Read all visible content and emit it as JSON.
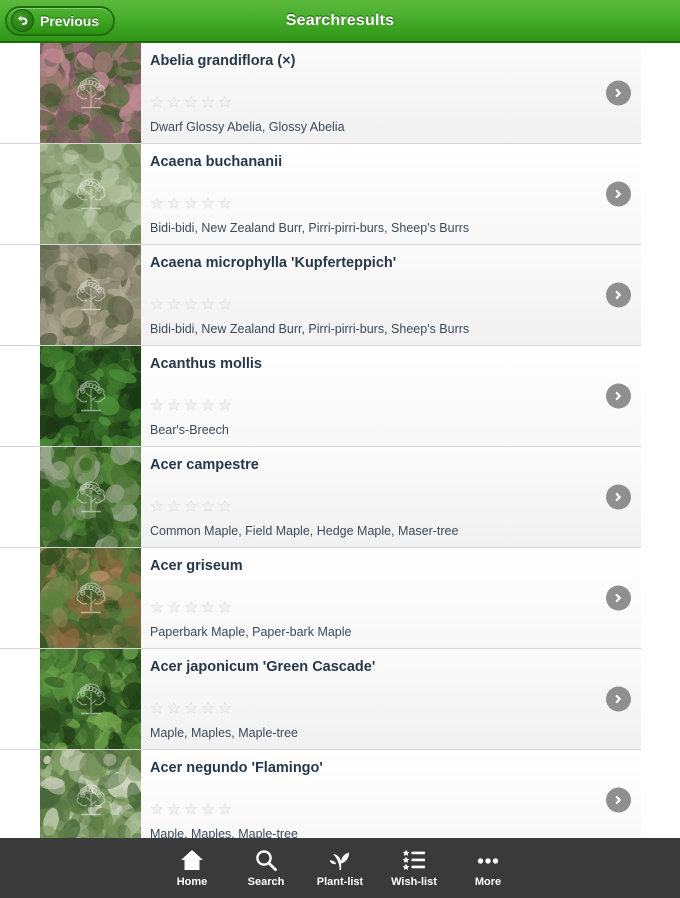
{
  "header": {
    "title": "Searchresults",
    "back_label": "Previous",
    "back_icon": "back-arrow-icon",
    "bg_color": "#47ad2c"
  },
  "results": [
    {
      "name": "Abelia grandiflora (×)",
      "common_names": "Dwarf Glossy Abelia, Glossy Abelia",
      "rating": 0,
      "max_rating": 5,
      "thumb_alt": "Abelia grandiflora photo",
      "thumb_palette": [
        "#7e5d62",
        "#9d7a72",
        "#5e7345",
        "#c08a93",
        "#46592f"
      ]
    },
    {
      "name": "Acaena buchananii",
      "common_names": "Bidi-bidi, New Zealand Burr, Pirri-pirri-burs, Sheep's Burrs",
      "rating": 0,
      "max_rating": 5,
      "thumb_alt": "Acaena buchananii photo",
      "thumb_palette": [
        "#93a57c",
        "#a8b78e",
        "#7d9166",
        "#b6c4a2",
        "#6d8257"
      ]
    },
    {
      "name": "Acaena microphylla 'Kupferteppich'",
      "common_names": "Bidi-bidi, New Zealand Burr, Pirri-pirri-burs, Sheep's Burrs",
      "rating": 0,
      "max_rating": 5,
      "thumb_alt": "Acaena microphylla photo",
      "thumb_palette": [
        "#8e8b74",
        "#a6a188",
        "#6f7357",
        "#b5ad96",
        "#5d6247"
      ]
    },
    {
      "name": "Acanthus mollis",
      "common_names": "Bear's-Breech",
      "rating": 0,
      "max_rating": 5,
      "thumb_alt": "Acanthus mollis photo",
      "thumb_palette": [
        "#2f5c22",
        "#3f7a2c",
        "#24491a",
        "#4e8f38",
        "#1b3a14"
      ]
    },
    {
      "name": "Acer campestre",
      "common_names": "Common Maple, Field Maple, Hedge Maple, Maser-tree",
      "rating": 0,
      "max_rating": 5,
      "thumb_alt": "Acer campestre hedge photo",
      "thumb_palette": [
        "#3d6b2a",
        "#55893a",
        "#2b4f1e",
        "#9aa68c",
        "#6d8a52"
      ]
    },
    {
      "name": "Acer griseum",
      "common_names": "Paperbark Maple, Paper-bark Maple",
      "rating": 0,
      "max_rating": 5,
      "thumb_alt": "Acer griseum bark photo",
      "thumb_palette": [
        "#4e6b33",
        "#8a6a3f",
        "#5f8340",
        "#b09063",
        "#36501f"
      ]
    },
    {
      "name": "Acer japonicum 'Green Cascade'",
      "common_names": "Maple, Maples, Maple-tree",
      "rating": 0,
      "max_rating": 5,
      "thumb_alt": "Acer japonicum photo",
      "thumb_palette": [
        "#3e6b2c",
        "#58913c",
        "#2a4d1d",
        "#74a84f",
        "#1f3c15"
      ]
    },
    {
      "name": "Acer negundo 'Flamingo'",
      "common_names": "Maple, Maples, Maple-tree",
      "rating": 0,
      "max_rating": 5,
      "thumb_alt": "Acer negundo Flamingo photo",
      "thumb_palette": [
        "#5f7f45",
        "#cfd6c0",
        "#47673a",
        "#9fb387",
        "#7d9a5e"
      ]
    }
  ],
  "row_chevron_icon": "chevron-right-icon",
  "tabbar": {
    "items": [
      {
        "label": "Home",
        "icon": "home-icon"
      },
      {
        "label": "Search",
        "icon": "search-icon"
      },
      {
        "label": "Plant-list",
        "icon": "plant-icon"
      },
      {
        "label": "Wish-list",
        "icon": "star-list-icon"
      },
      {
        "label": "More",
        "icon": "more-dots-icon"
      }
    ],
    "bg_color": "#3a3a3a"
  }
}
